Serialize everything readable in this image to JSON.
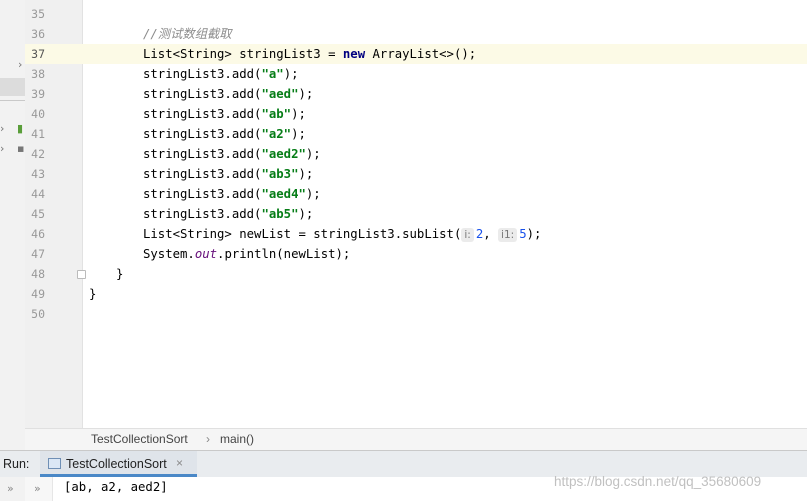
{
  "editor": {
    "lines": [
      {
        "num": "35"
      },
      {
        "num": "36",
        "comment": "//测试数组截取"
      },
      {
        "num": "37",
        "p1": "List<String> stringList3 = ",
        "kw": "new",
        "p2": " ArrayList<>();"
      },
      {
        "num": "38",
        "pre": "stringList3.add(",
        "arg": "\"a\"",
        "post": ");"
      },
      {
        "num": "39",
        "pre": "stringList3.add(",
        "arg": "\"aed\"",
        "post": ");"
      },
      {
        "num": "40",
        "pre": "stringList3.add(",
        "arg": "\"ab\"",
        "post": ");"
      },
      {
        "num": "41",
        "pre": "stringList3.add(",
        "arg": "\"a2\"",
        "post": ");"
      },
      {
        "num": "42",
        "pre": "stringList3.add(",
        "arg": "\"aed2\"",
        "post": ");"
      },
      {
        "num": "43",
        "pre": "stringList3.add(",
        "arg": "\"ab3\"",
        "post": ");"
      },
      {
        "num": "44",
        "pre": "stringList3.add(",
        "arg": "\"aed4\"",
        "post": ");"
      },
      {
        "num": "45",
        "pre": "stringList3.add(",
        "arg": "\"ab5\"",
        "post": ");"
      },
      {
        "num": "46",
        "p1": "List<String> newList = stringList3.subList(",
        "hint1": "i:",
        "v1": "2",
        "sep": ", ",
        "hint2": "i1:",
        "v2": "5",
        "p2": ");"
      },
      {
        "num": "47",
        "p1": "System.",
        "field": "out",
        "p2": ".println(newList);"
      },
      {
        "num": "48",
        "text": "}"
      },
      {
        "num": "49",
        "text": "}"
      },
      {
        "num": "50"
      }
    ]
  },
  "breadcrumb": {
    "class_name": "TestCollectionSort",
    "sep": "›",
    "method": "main()"
  },
  "run": {
    "label": "Run:",
    "tab_title": "TestCollectionSort",
    "close": "×",
    "output": "[ab, a2, aed2]"
  },
  "watermark": "https://blog.csdn.net/qq_35680609",
  "colors": {
    "string": "#067d17",
    "keyword": "#000080",
    "number": "#1750eb",
    "comment": "#8c8c8c",
    "active_line": "#fcfae6"
  }
}
